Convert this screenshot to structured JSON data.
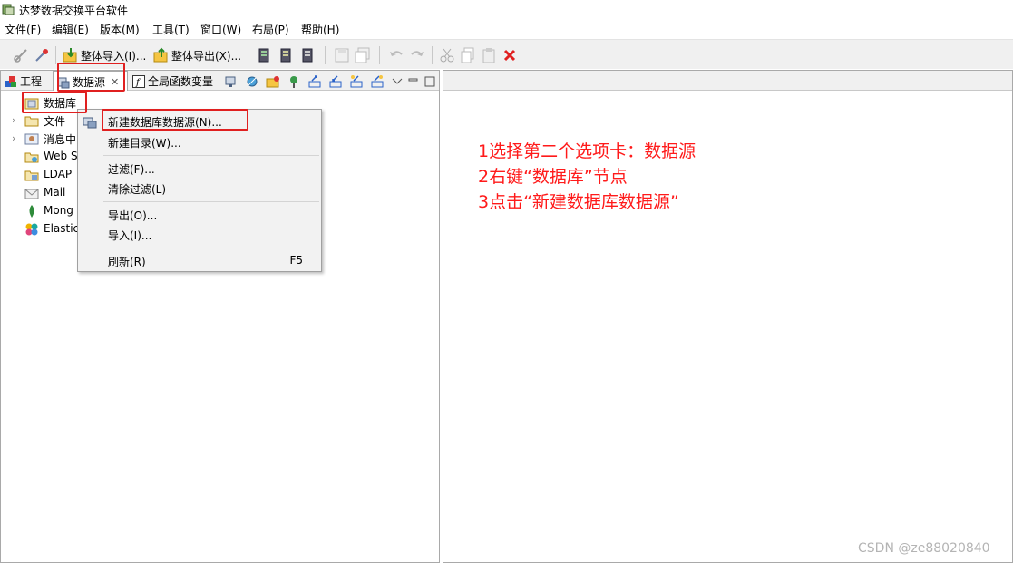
{
  "window": {
    "title": "达梦数据交换平台软件"
  },
  "menubar": {
    "items": [
      "文件(F)",
      "编辑(E)",
      "版本(M)",
      "工具(T)",
      "窗口(W)",
      "布局(P)",
      "帮助(H)"
    ]
  },
  "toolbar": {
    "import_all": "整体导入(I)...",
    "export_all": "整体导出(X)..."
  },
  "tabs": {
    "project": "工程",
    "datasource": "数据源",
    "global_vars": "全局函数变量"
  },
  "tree": {
    "root": "数据库",
    "items": [
      "文件",
      "消息中",
      "Web S",
      "LDAP",
      "Mail",
      "Mong",
      "Elastic"
    ]
  },
  "context_menu": {
    "new_db_source": "新建数据库数据源(N)...",
    "new_dir": "新建目录(W)...",
    "filter": "过滤(F)...",
    "clear_filter": "清除过滤(L)",
    "export": "导出(O)...",
    "import": "导入(I)...",
    "refresh": "刷新(R)",
    "refresh_shortcut": "F5"
  },
  "annotation": {
    "line1": "1选择第二个选项卡：数据源",
    "line2": "2右键“数据库”节点",
    "line3": "3点击“新建数据库数据源”"
  },
  "watermark": "CSDN @ze88020840",
  "colors": {
    "highlight": "#e02020",
    "annotation": "#ff1a1a"
  }
}
